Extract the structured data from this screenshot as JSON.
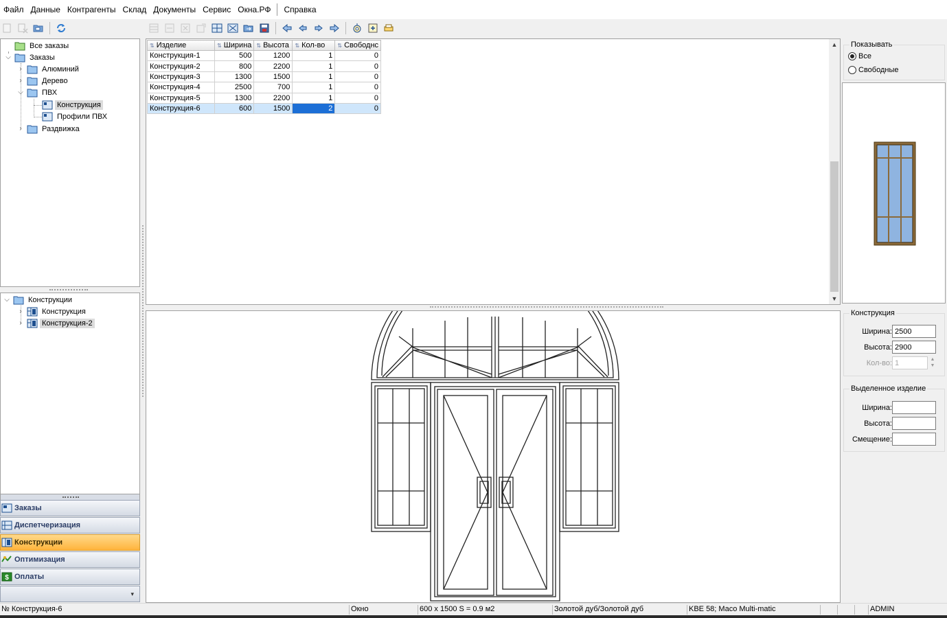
{
  "menu": [
    "Файл",
    "Данные",
    "Контрагенты",
    "Склад",
    "Документы",
    "Сервис",
    "Окна.РФ",
    "Справка"
  ],
  "tree_top": {
    "all_orders": "Все заказы",
    "orders": "Заказы",
    "aluminum": "Алюминий",
    "wood": "Дерево",
    "pvc": "ПВХ",
    "construction": "Конструкция",
    "pvc_profiles": "Профили ПВХ",
    "sliding": "Раздвижка"
  },
  "tree_bottom": {
    "root": "Конструкции",
    "item1": "Конструкция",
    "item2": "Конструкция-2"
  },
  "nav": {
    "orders": "Заказы",
    "dispatch": "Диспетчеризация",
    "constructions": "Конструкции",
    "optimization": "Оптимизация",
    "payments": "Оплаты"
  },
  "grid": {
    "headers": [
      "Изделие",
      "Ширина",
      "Высота",
      "Кол-во",
      "Свободнс"
    ],
    "rows": [
      [
        "Конструкция-1",
        "500",
        "1200",
        "1",
        "0"
      ],
      [
        "Конструкция-2",
        "800",
        "2200",
        "1",
        "0"
      ],
      [
        "Конструкция-3",
        "1300",
        "1500",
        "1",
        "0"
      ],
      [
        "Конструкция-4",
        "2500",
        "700",
        "1",
        "0"
      ],
      [
        "Конструкция-5",
        "1300",
        "2200",
        "1",
        "0"
      ],
      [
        "Конструкция-6",
        "600",
        "1500",
        "2",
        "0"
      ]
    ],
    "selected_row": 5
  },
  "right": {
    "show_title": "Показывать",
    "show_all": "Все",
    "show_free": "Свободные",
    "construction_title": "Конструкция",
    "width_label": "Ширина:",
    "width_value": "2500",
    "height_label": "Высота:",
    "height_value": "2900",
    "qty_label": "Кол-во:",
    "qty_value": "1",
    "selected_title": "Выделенное изделие",
    "sel_width_label": "Ширина:",
    "sel_height_label": "Высота:",
    "sel_offset_label": "Смещение:"
  },
  "status": {
    "item": "№ Конструкция-6",
    "type": "Окно",
    "size": "600 x 1500   S = 0.9 м2",
    "color": "Золотой дуб/Золотой дуб",
    "profile": "KBE 58;  Maco Multi-matic",
    "user": "ADMIN"
  },
  "colors": {
    "nav_active": "#ffb43c",
    "row_selected": "#cfe6fb",
    "cell_focus": "#1c6fd6",
    "preview_frame": "#8b6a3a",
    "preview_glass": "#8fb4e0"
  }
}
